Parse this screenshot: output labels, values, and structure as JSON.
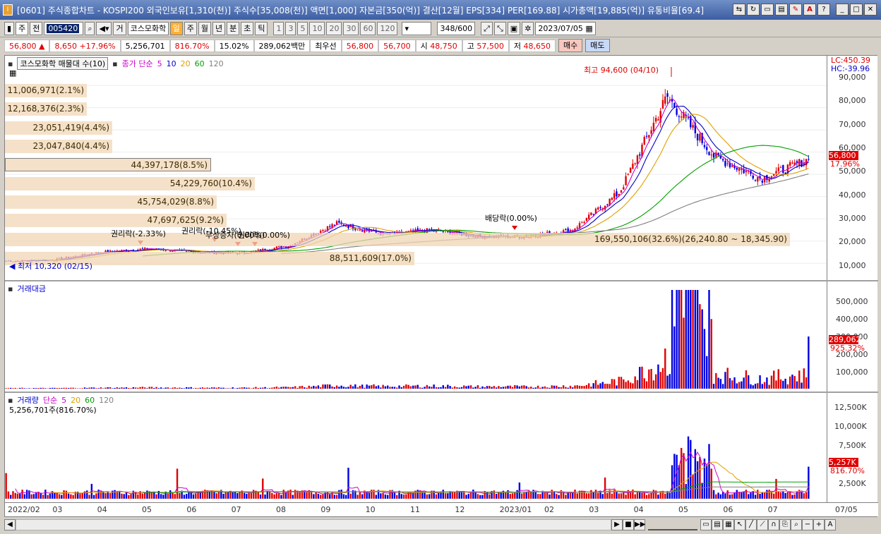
{
  "window": {
    "title": "[0601] 주식종합차트 - KOSPI200 외국인보유[1,310(천)] 주식수[35,008(천)] 액면[1,000] 자본금[350(억)] 결산[12월] EPS[334] PER[169.88] 시가총액[19,885(억)] 유통비율[69.4]",
    "app_icon": "I"
  },
  "toolbar": {
    "period_select": "주",
    "prev_label": "전",
    "code": "005420",
    "mode_label": "거",
    "stock_name": "코스모화학",
    "period_tabs": [
      "일",
      "주",
      "월",
      "년",
      "분",
      "초",
      "틱"
    ],
    "active_period": "일",
    "intervals": [
      "1",
      "3",
      "5",
      "10",
      "20",
      "30",
      "60",
      "120"
    ],
    "count": "348",
    "count_total": "/600",
    "date": "2023/07/05"
  },
  "quote": {
    "price": "56,800",
    "change": "8,650",
    "change_pct": "+17.96%",
    "volume": "5,256,701",
    "volume_pct": "816.70%",
    "turnover_pct": "15.02%",
    "amount": "289,062백만",
    "best_label": "최우선",
    "ask": "56,800",
    "bid": "56,700",
    "open_label": "시",
    "open": "48,750",
    "high_label": "고",
    "high": "57,500",
    "low_label": "저",
    "low": "48,650",
    "buy_label": "매수",
    "sell_label": "매도"
  },
  "price_pane": {
    "title": "코스모화학 매물대 수(10)",
    "legend_label": "종가 단순",
    "ma_periods": [
      "5",
      "10",
      "20",
      "60",
      "120"
    ],
    "ma_colors": [
      "#cc00cc",
      "#0000cc",
      "#e0a000",
      "#00a000",
      "#808080"
    ],
    "lc": "LC:450.39",
    "hc": "HC:-39.96",
    "last_price": "56,800",
    "last_pct": "17.96%",
    "high_annotation": "최고 94,600 (04/10)",
    "low_annotation": "최저 10,320 (02/15)",
    "event_labels": [
      "권리락(-2.33%)",
      "권리락(-10.45%)",
      "무상증자(0.00%)",
      "권리락(0.00%)",
      "배당락(0.00%)"
    ],
    "volume_profile": [
      "11,006,971(2.1%)",
      "12,168,376(2.3%)",
      "23,051,419(4.4%)",
      "23,047,840(4.4%)",
      "44,397,178(8.5%)",
      "54,229,760(10.4%)",
      "45,754,029(8.8%)",
      "47,697,625(9.2%)",
      "169,550,106(32.6%)(26,240.80 ~ 18,345.90)",
      "88,511,609(17.0%)"
    ],
    "y_ticks": [
      "90,000",
      "80,000",
      "70,000",
      "60,000",
      "50,000",
      "40,000",
      "30,000",
      "20,000",
      "10,000"
    ]
  },
  "amount_pane": {
    "title": "거래대금",
    "last_value": "289,062",
    "last_pct": "925.32%",
    "y_ticks": [
      "500,000",
      "400,000",
      "300,000",
      "200,000",
      "100,000"
    ]
  },
  "volume_pane": {
    "title": "거래량",
    "legend_label": "단순",
    "ma_periods": [
      "5",
      "20",
      "60",
      "120"
    ],
    "ma_colors": [
      "#cc00cc",
      "#e0a000",
      "#00a000",
      "#808080"
    ],
    "summary": "5,256,701주(816.70%)",
    "last_value": "5,257K",
    "last_pct": "816.70%",
    "y_ticks": [
      "12,500K",
      "10,000K",
      "7,500K",
      "5,000K",
      "2,500K"
    ]
  },
  "x_axis": {
    "labels": [
      "2022/02",
      "03",
      "04",
      "05",
      "06",
      "07",
      "08",
      "09",
      "10",
      "11",
      "12",
      "2023/01",
      "02",
      "03",
      "04",
      "05",
      "06",
      "07"
    ],
    "right_label": "07/05"
  },
  "chart_data": {
    "type": "candlestick",
    "x": [
      "2022-02",
      "2022-03",
      "2022-04",
      "2022-05",
      "2022-06",
      "2022-07",
      "2022-08",
      "2022-09",
      "2022-10",
      "2022-11",
      "2022-12",
      "2023-01",
      "2023-02",
      "2023-03",
      "2023-04",
      "2023-05",
      "2023-06",
      "2023-07"
    ],
    "close_approx": [
      11000,
      11500,
      15000,
      16500,
      15000,
      14500,
      18000,
      28000,
      23000,
      25000,
      22000,
      22000,
      25000,
      42000,
      85000,
      58000,
      48000,
      56800
    ],
    "ylim": [
      5000,
      97000
    ],
    "colors": {
      "up": "#e00000",
      "down": "#0000e0"
    }
  }
}
